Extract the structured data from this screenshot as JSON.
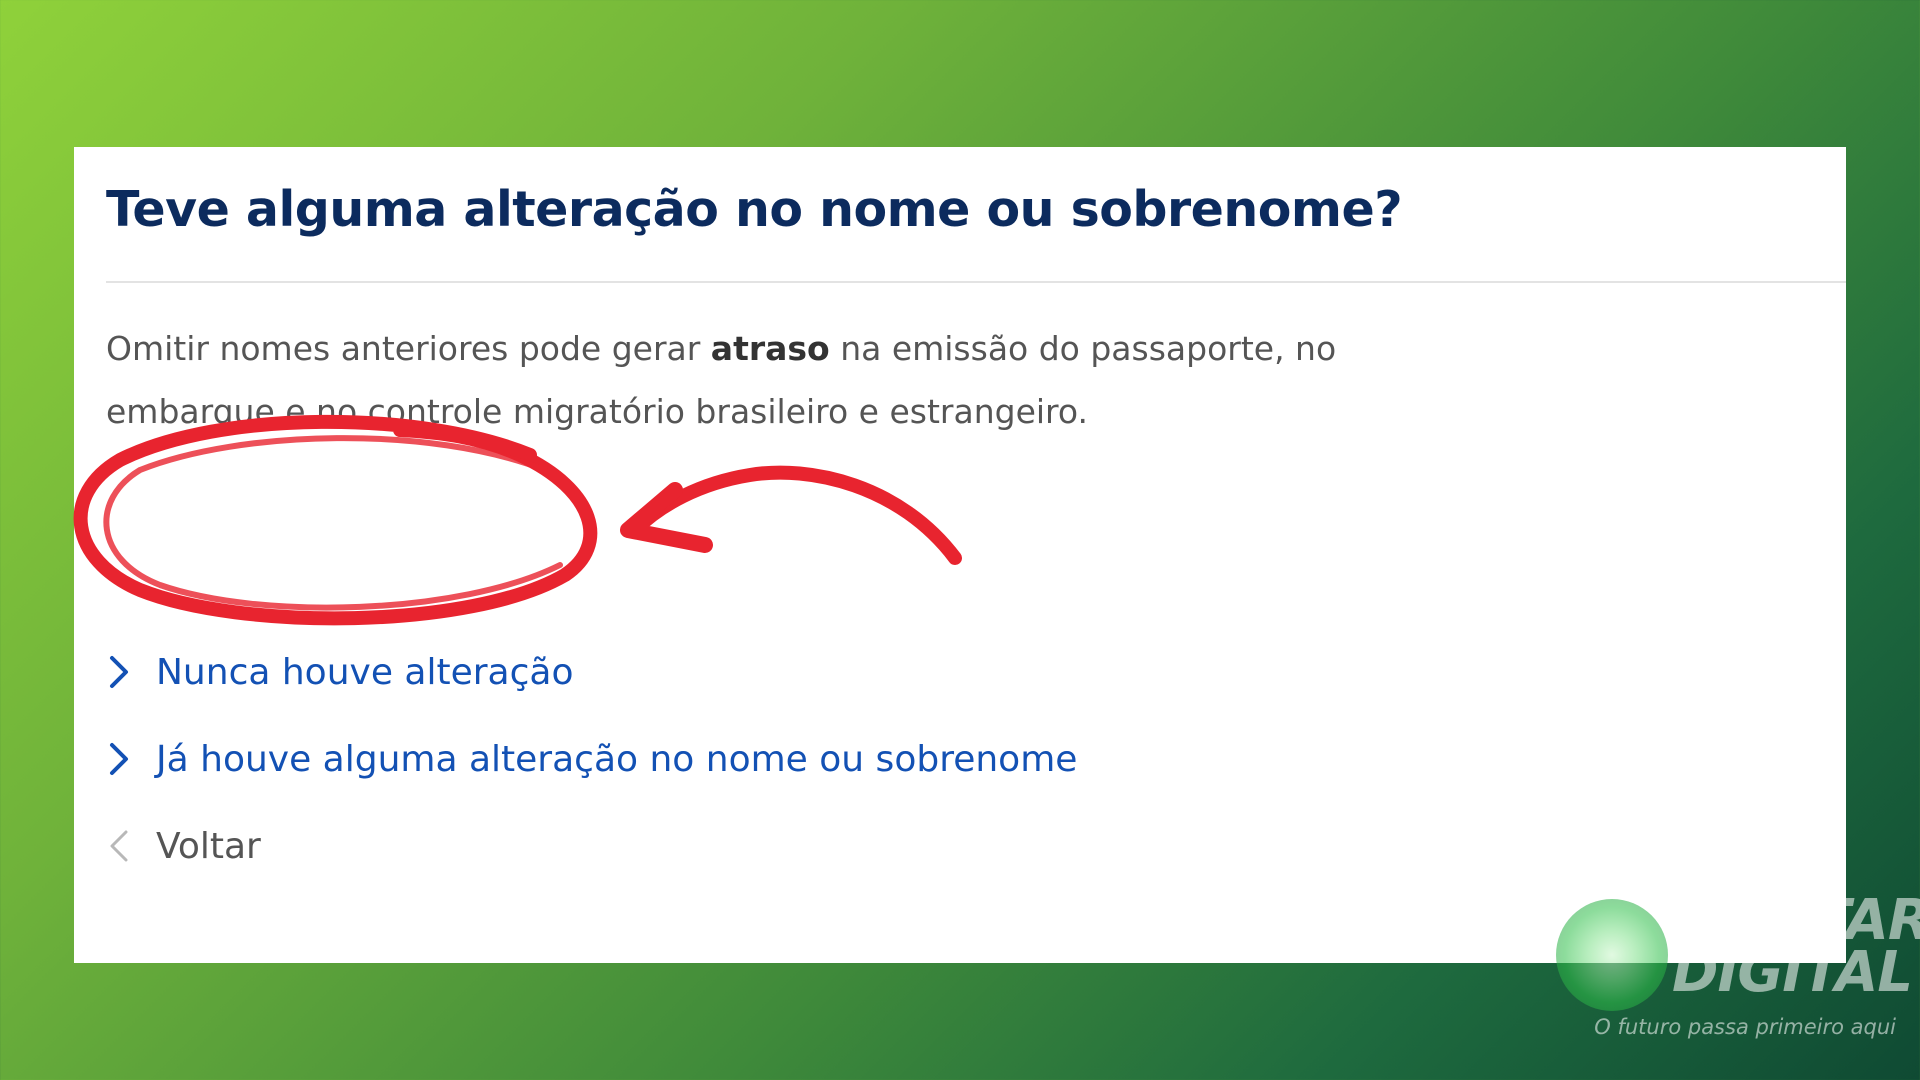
{
  "form": {
    "title": "Teve alguma alteração no nome ou sobrenome?",
    "description": {
      "before": "Omitir nomes anteriores pode gerar ",
      "emphasis": "atraso",
      "after": " na emissão do passaporte, no embarque e no controle migratório brasileiro e estrangeiro."
    },
    "options": [
      {
        "label": "Nunca houve alteração",
        "icon": "chevron-right-icon"
      },
      {
        "label": "Já houve alguma alteração no nome ou sobrenome",
        "icon": "chevron-right-icon"
      }
    ],
    "back": {
      "label": "Voltar",
      "icon": "chevron-left-icon"
    }
  },
  "watermark": {
    "name_line1": "MOSTAR",
    "name_line2": "DIGITAL",
    "slogan": "O futuro passa primeiro aqui"
  },
  "colors": {
    "title": "#0c2b5e",
    "link": "#1351b4",
    "text": "#555555",
    "annotation": "#e8242f"
  }
}
